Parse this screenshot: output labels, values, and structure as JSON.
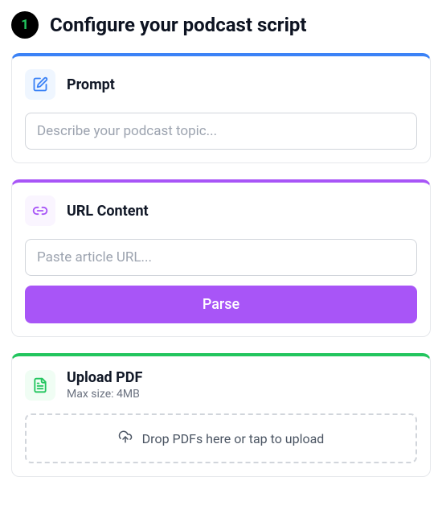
{
  "header": {
    "step": "1",
    "title": "Configure your podcast script"
  },
  "prompt_card": {
    "title": "Prompt",
    "placeholder": "Describe your podcast topic...",
    "value": ""
  },
  "url_card": {
    "title": "URL Content",
    "placeholder": "Paste article URL...",
    "value": "",
    "button": "Parse"
  },
  "pdf_card": {
    "title": "Upload PDF",
    "subtitle": "Max size: 4MB",
    "dropzone": "Drop PDFs here or tap to upload"
  },
  "colors": {
    "blue": "#3b82f6",
    "purple": "#a855f7",
    "green": "#22c55e"
  }
}
